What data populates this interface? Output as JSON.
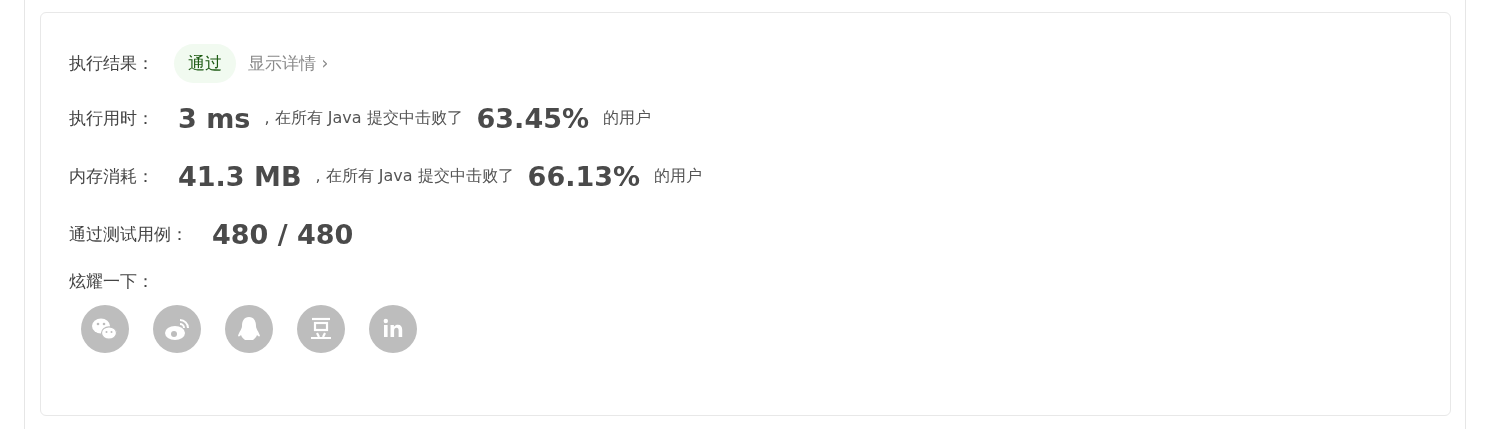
{
  "result": {
    "label": "执行结果：",
    "status": "通过",
    "details_link": "显示详情 ›"
  },
  "stats": [
    {
      "label": "执行用时：",
      "value": "3 ms",
      "text": ", 在所有 Java 提交中击败了",
      "percent": "63.45%",
      "suffix": "的用户"
    },
    {
      "label": "内存消耗：",
      "value": "41.3 MB",
      "text": ", 在所有 Java 提交中击败了",
      "percent": "66.13%",
      "suffix": "的用户"
    }
  ],
  "tests": {
    "label": "通过测试用例：",
    "value": "480 / 480"
  },
  "share": {
    "label": "炫耀一下：",
    "icons": [
      {
        "kind": "wechat"
      },
      {
        "kind": "weibo"
      },
      {
        "kind": "qq"
      },
      {
        "kind": "douban"
      },
      {
        "kind": "linkedin"
      }
    ]
  }
}
